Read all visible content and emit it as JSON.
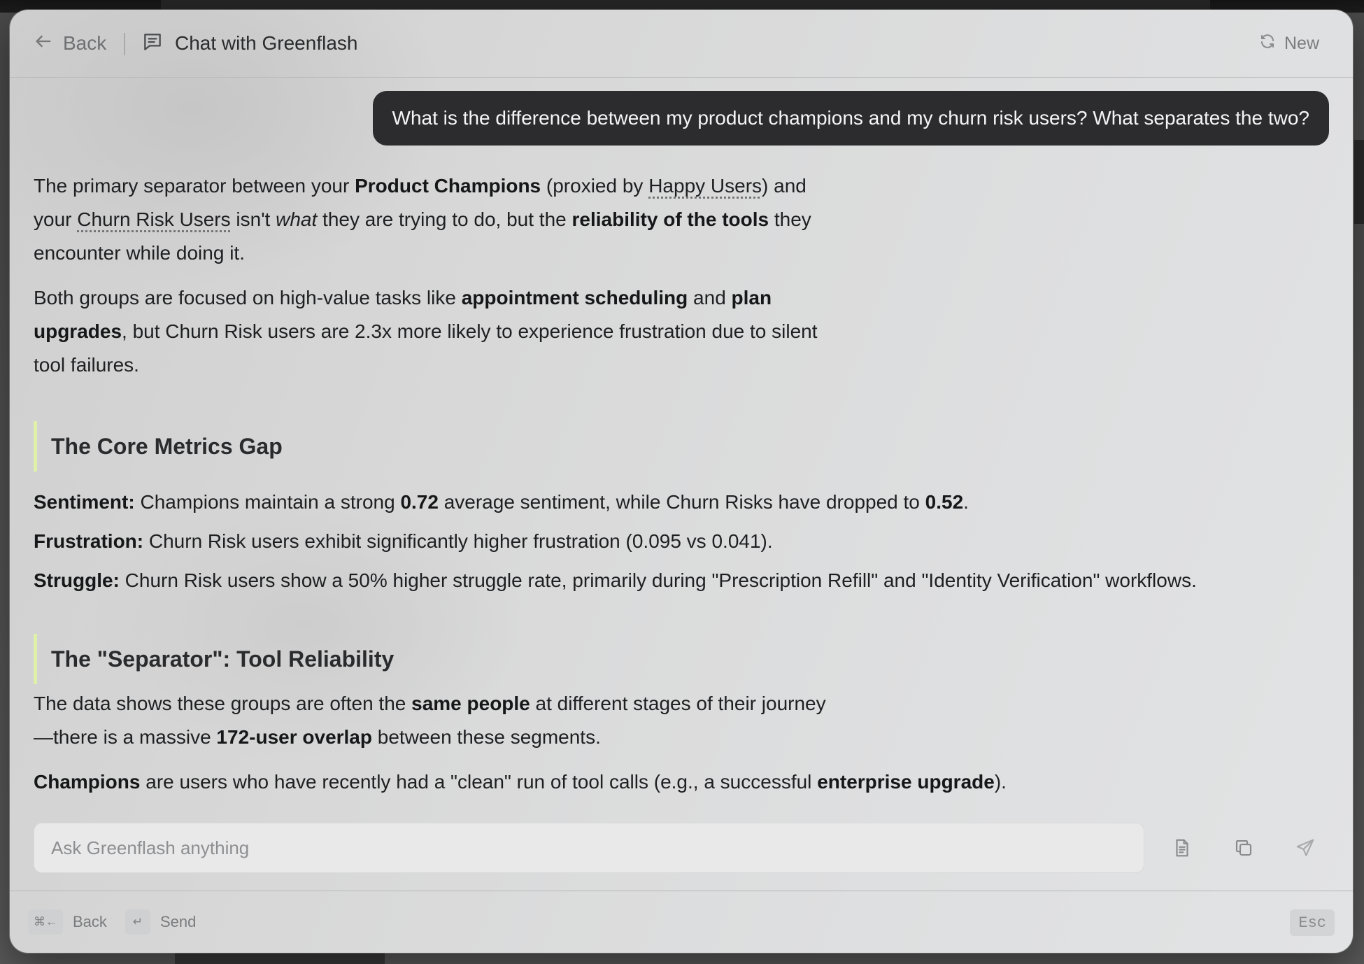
{
  "header": {
    "back_label": "Back",
    "title": "Chat with Greenflash",
    "new_label": "New"
  },
  "conversation": {
    "user_message": "What is the difference between my product champions and my churn risk users? What separates the two?",
    "p1": {
      "t1": "The primary separator between your ",
      "b1": "Product Champions",
      "t2": " (proxied by ",
      "link1": "Happy Users",
      "t3": ") and your ",
      "link2": "Churn Risk Users",
      "t4": " isn't ",
      "i1": "what",
      "t5": " they are trying to do, but the ",
      "b2": "reliability of the tools",
      "t6": " they encounter while doing it."
    },
    "p2": {
      "t1": "Both groups are focused on high-value tasks like ",
      "b1": "appointment scheduling",
      "t2": " and ",
      "b2": "plan upgrades",
      "t3": ", but Churn Risk users are 2.3x more likely to experience frustration due to silent tool failures."
    },
    "section1_title": "The Core Metrics Gap",
    "metrics": [
      {
        "label": "Sentiment:",
        "t1": " Champions maintain a strong ",
        "b1": "0.72",
        "t2": " average sentiment, while Churn Risks have dropped to ",
        "b2": "0.52",
        "t3": "."
      },
      {
        "label": "Frustration:",
        "t1": " Churn Risk users exhibit significantly higher frustration (0.095 vs 0.041)."
      },
      {
        "label": "Struggle:",
        "t1": " Churn Risk users show a 50% higher struggle rate, primarily during \"Prescription Refill\" and \"Identity Verification\" workflows."
      }
    ],
    "section2_title": "The \"Separator\": Tool Reliability",
    "p3": {
      "t1": "The data shows these groups are often the ",
      "b1": "same people",
      "t2": " at different stages of their journey—there is a massive ",
      "b2": "172-user overlap",
      "t3": " between these segments."
    },
    "p4": {
      "b1": "Champions",
      "t1": " are users who have recently had a \"clean\" run of tool calls (e.g., a successful ",
      "b2": "enterprise upgrade",
      "t2": ")."
    }
  },
  "composer": {
    "placeholder": "Ask Greenflash anything"
  },
  "footer": {
    "back_key": "⌘←",
    "back_label": "Back",
    "send_key": "↵",
    "send_label": "Send",
    "esc_label": "Esc"
  },
  "colors": {
    "accent_bar": "#dff0a8",
    "user_bubble": "#2c2c2e"
  }
}
